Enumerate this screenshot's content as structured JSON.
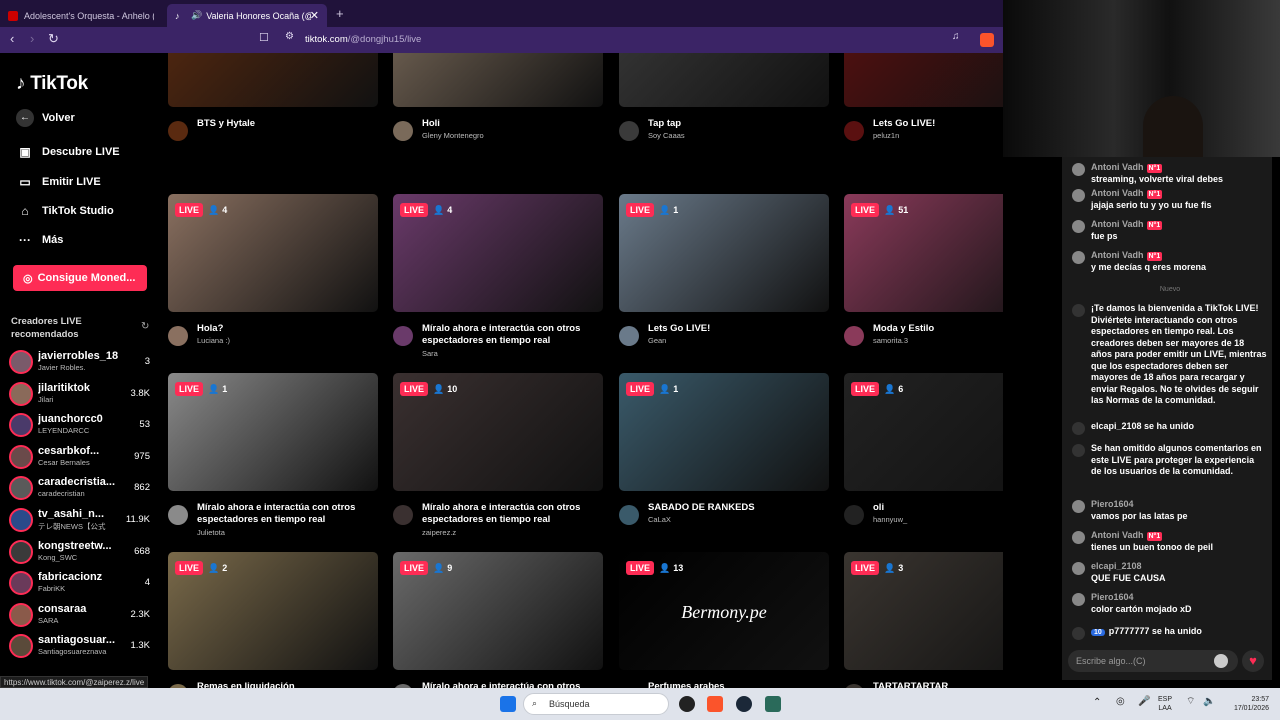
{
  "browser": {
    "tabs": [
      {
        "title": "Adolescent's Orquesta - Anhelo (Letr"
      },
      {
        "title": "Valeria Honores Ocaña (@do",
        "active": true
      }
    ],
    "new_tab": "+",
    "url_host": "tiktok.com",
    "url_path": "/@dongjhu15/live"
  },
  "sidebar": {
    "logo": "TikTok",
    "back": "Volver",
    "nav": [
      {
        "label": "Descubre LIVE",
        "icon": "live-discover-icon"
      },
      {
        "label": "Emitir LIVE",
        "icon": "camera-icon"
      },
      {
        "label": "TikTok Studio",
        "icon": "studio-icon"
      },
      {
        "label": "Más",
        "icon": "more-icon"
      }
    ],
    "coins_button": "Consigue Moned...",
    "recommended_title_1": "Creadores LIVE",
    "recommended_title_2": "recomendados",
    "creators": [
      {
        "name": "javierrobles_18",
        "sub": "Javier Robles.",
        "count": "3",
        "color": "#7a5a6a"
      },
      {
        "name": "jilaritiktok",
        "sub": "Jilari",
        "count": "3.8K",
        "color": "#8a6a5a"
      },
      {
        "name": "juanchorcc0",
        "sub": "LEYENDARCC",
        "count": "53",
        "color": "#4a3a6a"
      },
      {
        "name": "cesarbkof...",
        "sub": "Cesar Bernales",
        "count": "975",
        "color": "#6a4a4a"
      },
      {
        "name": "caradecristia...",
        "sub": "caradecristian",
        "count": "862",
        "color": "#5a5a5a"
      },
      {
        "name": "tv_asahi_n...",
        "sub": "テレ朝NEWS【公式",
        "count": "11.9K",
        "color": "#2a4a8a"
      },
      {
        "name": "kongstreetw...",
        "sub": "Kong_SWC",
        "count": "668",
        "color": "#3a3a3a"
      },
      {
        "name": "fabricacionz",
        "sub": "FabriKK",
        "count": "4",
        "color": "#6a3a5a"
      },
      {
        "name": "consaraa",
        "sub": "SARA",
        "count": "2.3K",
        "color": "#8a5a4a"
      },
      {
        "name": "santiagosuar...",
        "sub": "Santiagosuareznava",
        "count": "1.3K",
        "color": "#5a4a3a"
      }
    ],
    "status_url": "https://www.tiktok.com/@zaiperez.z/live"
  },
  "grid": [
    {
      "title": "BTS y Hytale",
      "author": "",
      "viewers": "",
      "bg": "#5a2a10"
    },
    {
      "title": "Holi",
      "author": "Gleny Montenegro",
      "viewers": "",
      "bg": "#7a6a5a"
    },
    {
      "title": "Tap tap",
      "author": "Soy Caaas",
      "viewers": "",
      "bg": "#3a3a3a"
    },
    {
      "title": "Lets Go LIVE!",
      "author": "peluz1n",
      "viewers": "",
      "bg": "#5a1010"
    },
    {
      "title": "Hola?",
      "author": "Luciana :)",
      "viewers": "4",
      "bg": "#8a7060"
    },
    {
      "title": "Míralo ahora e interactúa con otros espectadores en tiempo real",
      "author": "Sara",
      "viewers": "4",
      "bg": "#6a3a6a"
    },
    {
      "title": "Lets Go LIVE!",
      "author": "Gean",
      "viewers": "1",
      "bg": "#6a7a8a"
    },
    {
      "title": "Moda y Estilo",
      "author": "samorita.3",
      "viewers": "51",
      "bg": "#8a3a5a"
    },
    {
      "title": "Míralo ahora e interactúa con otros espectadores en tiempo real",
      "author": "Julietota",
      "viewers": "1",
      "bg": "#8a8a8a"
    },
    {
      "title": "Míralo ahora e interactúa con otros espectadores en tiempo real",
      "author": "zaiperez.z",
      "viewers": "10",
      "bg": "#3a3030"
    },
    {
      "title": "SABADO DE RANKEDS",
      "author": "CaLaX",
      "viewers": "1",
      "bg": "#3a5a6a"
    },
    {
      "title": "oli",
      "author": "hannyuw_",
      "viewers": "6",
      "bg": "#222222"
    },
    {
      "title": "Remas en liquidación",
      "author": "",
      "viewers": "2",
      "bg": "#7a6a4a"
    },
    {
      "title": "Míralo ahora e interactúa con otros",
      "author": "",
      "viewers": "9",
      "bg": "#6a6a6a"
    },
    {
      "title": "Perfumes arabes",
      "author": "",
      "viewers": "13",
      "bg": "#000000",
      "overlay": "Bermony.pe"
    },
    {
      "title": "TARTARTARTAR",
      "author": "",
      "viewers": "3",
      "bg": "#3a3530"
    }
  ],
  "live_label": "LIVE",
  "chat": {
    "messages": [
      {
        "user": "Antoni Vadh",
        "rank": "N°1",
        "text": "streaming, volverte viral debes"
      },
      {
        "user": "Antoni Vadh",
        "rank": "N°1",
        "text": "jajaja serio tu y yo uu fue fis"
      },
      {
        "user": "Antoni Vadh",
        "rank": "N°1",
        "text": "fue ps"
      },
      {
        "user": "Antoni Vadh",
        "rank": "N°1",
        "text": "y me decías q eres morena"
      }
    ],
    "divider": "Nuevo",
    "system_welcome": "¡Te damos la bienvenida a TikTok LIVE! Diviértete interactuando con otros espectadores en tiempo real. Los creadores deben ser mayores de 18 años para poder emitir un LIVE, mientras que los espectadores deben ser mayores de 18 años para recargar y enviar Regalos. No te olvides de seguir las Normas de la comunidad.",
    "join1": "elcapi_2108 se ha unido",
    "system_omitted": "Se han omitido algunos comentarios en este LIVE para proteger la experiencia de los usuarios de la comunidad.",
    "later": [
      {
        "user": "Piero1604",
        "text": "vamos por las latas pe"
      },
      {
        "user": "Antoni Vadh",
        "rank": "N°1",
        "text": "tienes un buen tonoo de peil"
      },
      {
        "user": "elcapi_2108",
        "text": "QUE FUE CAUSA"
      },
      {
        "user": "Piero1604",
        "text": "color cartón mojado xD"
      }
    ],
    "join2_level": "10",
    "join2": "p7777777 se ha unido",
    "input_placeholder": "Escribe algo...(C)"
  },
  "taskbar": {
    "search": "Búsqueda",
    "lang": "ESP",
    "lang2": "LAA",
    "time": "23:57",
    "date": "17/01/2026"
  }
}
